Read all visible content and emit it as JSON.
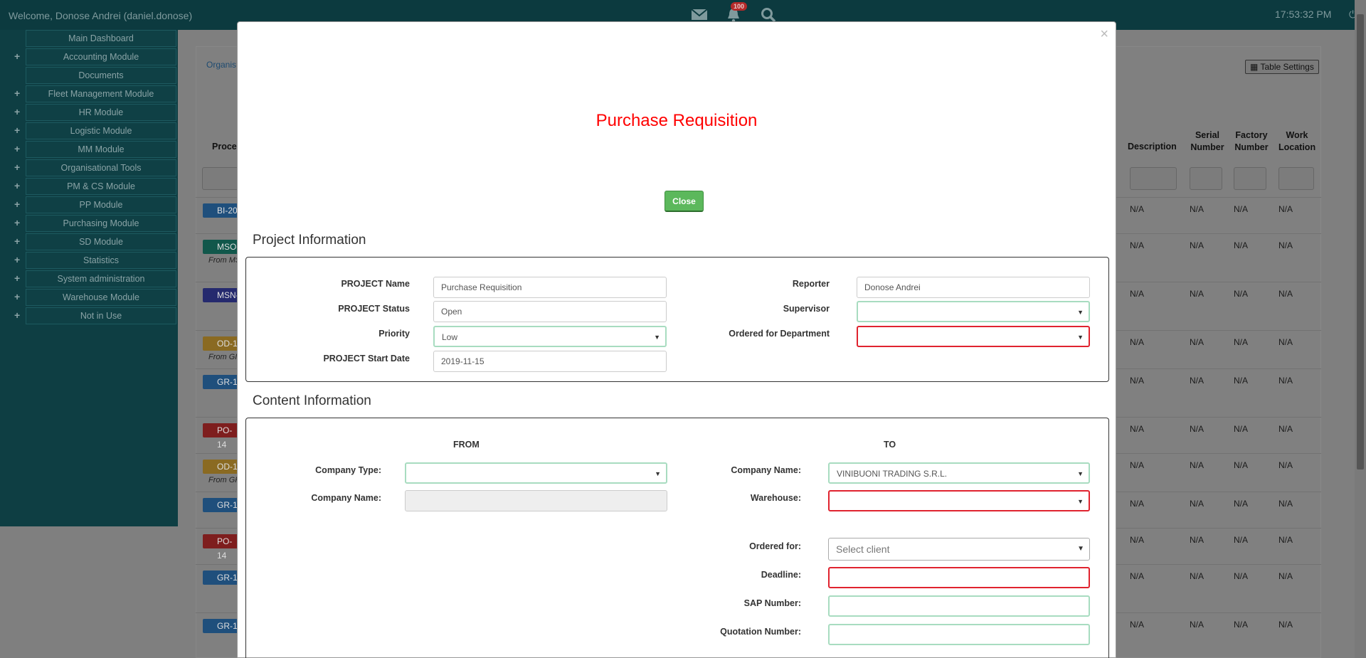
{
  "topbar": {
    "welcome": "Welcome, Donose Andrei (daniel.donose)",
    "notification_count": "100",
    "time": "17:53:32 PM",
    "icons": [
      "mail-icon",
      "bell-icon",
      "search-icon",
      "power-icon"
    ]
  },
  "sidebar": {
    "items": [
      {
        "label": "Main Dashboard",
        "expandable": false
      },
      {
        "label": "Accounting Module",
        "expandable": true
      },
      {
        "label": "Documents",
        "expandable": false
      },
      {
        "label": "Fleet Management Module",
        "expandable": true
      },
      {
        "label": "HR Module",
        "expandable": true
      },
      {
        "label": "Logistic Module",
        "expandable": true
      },
      {
        "label": "MM Module",
        "expandable": true
      },
      {
        "label": "Organisational Tools",
        "expandable": true
      },
      {
        "label": "PM & CS Module",
        "expandable": true
      },
      {
        "label": "PP Module",
        "expandable": true
      },
      {
        "label": "Purchasing Module",
        "expandable": true
      },
      {
        "label": "SD Module",
        "expandable": true
      },
      {
        "label": "Statistics",
        "expandable": true
      },
      {
        "label": "System administration",
        "expandable": true
      },
      {
        "label": "Warehouse Module",
        "expandable": true
      },
      {
        "label": "Not in Use",
        "expandable": true
      }
    ]
  },
  "background": {
    "breadcrumb": "Organis",
    "table_settings": "Table Settings",
    "column_headers": {
      "process": "Proce",
      "description": "Description",
      "serial_number": [
        "Serial",
        "Number"
      ],
      "factory_number": [
        "Factory",
        "Number"
      ],
      "work_location": [
        "Work",
        "Location"
      ]
    },
    "rows": [
      {
        "tag": "BI-20",
        "color": "#1f4f7c",
        "sub": ""
      },
      {
        "tag": "MSO-",
        "color": "#11574b",
        "sub": "From MS"
      },
      {
        "tag": "MSN-",
        "color": "#252a6e",
        "sub": ""
      },
      {
        "tag": "OD-1",
        "color": "#8a6a22",
        "sub": "From GI"
      },
      {
        "tag": "GR-1",
        "color": "#1f4f7c",
        "sub": ""
      },
      {
        "tag": "PO-14",
        "color": "#7e1e1e",
        "sub": ""
      },
      {
        "tag": "OD-1",
        "color": "#8a6a22",
        "sub": "From GR"
      },
      {
        "tag": "GR-1",
        "color": "#1f4f7c",
        "sub": ""
      },
      {
        "tag": "PO-14",
        "color": "#7e1e1e",
        "sub": ""
      },
      {
        "tag": "GR-1",
        "color": "#1f4f7c",
        "sub": ""
      },
      {
        "tag": "GR-1",
        "color": "#1f4f7c",
        "sub": ""
      }
    ],
    "na": "N/A"
  },
  "modal": {
    "close_x": "×",
    "title": "Purchase Requisition",
    "close_button": "Close",
    "project_section": {
      "title": "Project Information",
      "project_name_label": "PROJECT Name",
      "project_name_value": "Purchase Requisition",
      "project_status_label": "PROJECT Status",
      "project_status_value": "Open",
      "priority_label": "Priority",
      "priority_value": "Low",
      "start_date_label": "PROJECT Start Date",
      "start_date_value": "2019-11-15",
      "reporter_label": "Reporter",
      "reporter_value": "Donose Andrei",
      "supervisor_label": "Supervisor",
      "supervisor_value": "",
      "department_label": "Ordered for Department",
      "department_value": ""
    },
    "content_section": {
      "title": "Content Information",
      "from_header": "FROM",
      "to_header": "TO",
      "from_company_type_label": "Company Type:",
      "from_company_type_value": "",
      "from_company_name_label": "Company Name:",
      "from_company_name_value": "",
      "to_company_name_label": "Company Name:",
      "to_company_name_value": "VINIBUONI TRADING S.R.L.",
      "warehouse_label": "Warehouse:",
      "warehouse_value": "",
      "ordered_for_label": "Ordered for:",
      "ordered_for_placeholder": "Select client",
      "deadline_label": "Deadline:",
      "deadline_value": "",
      "sap_label": "SAP Number:",
      "sap_value": "",
      "quotation_label": "Quotation Number:",
      "quotation_value": ""
    }
  },
  "colors": {
    "title_red": "#ff0000",
    "close_green": "#5cb85c",
    "valid_border": "#a8dcc0",
    "invalid_border": "#e0232f",
    "sidebar_bg": "#0e3e43"
  }
}
